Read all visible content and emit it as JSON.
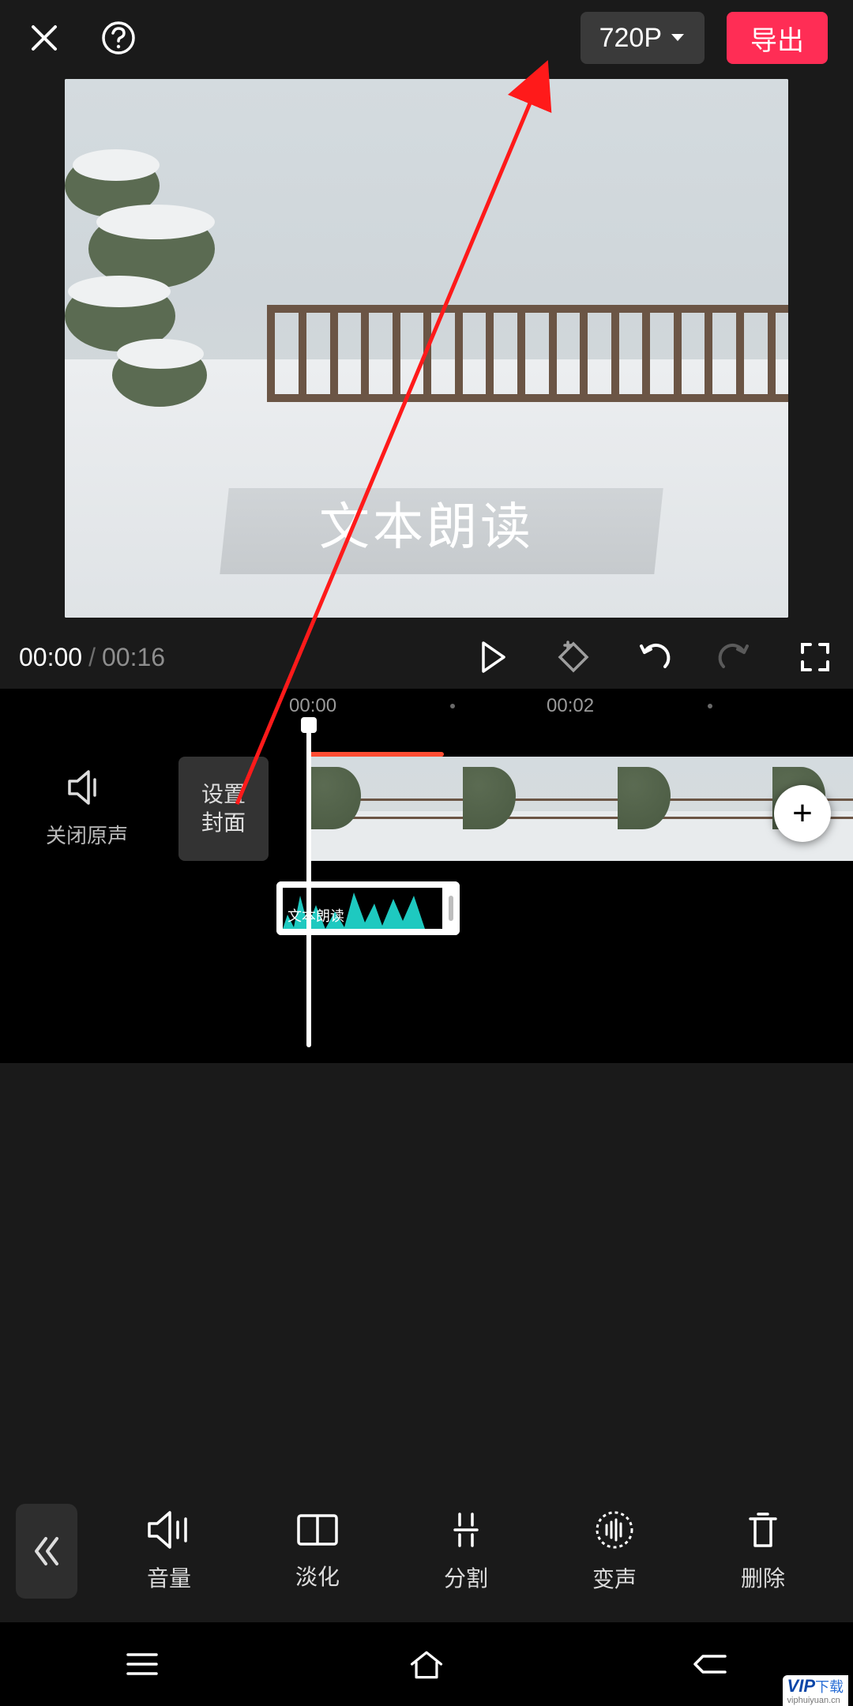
{
  "header": {
    "resolution_label": "720P",
    "export_label": "导出"
  },
  "preview": {
    "overlay_text": "文本朗读"
  },
  "playbar": {
    "current_time": "00:00",
    "duration": "00:16"
  },
  "ruler": {
    "tick_a": "00:00",
    "tick_b": "00:02"
  },
  "timeline": {
    "mute_label": "关闭原声",
    "cover_label": "设置\n封面",
    "audio_clip_label": "文本朗读"
  },
  "toolbar": {
    "items": [
      {
        "label": "音量",
        "icon": "volume-icon"
      },
      {
        "label": "淡化",
        "icon": "fade-icon"
      },
      {
        "label": "分割",
        "icon": "split-icon"
      },
      {
        "label": "变声",
        "icon": "voice-change-icon"
      },
      {
        "label": "删除",
        "icon": "delete-icon"
      }
    ]
  },
  "watermark": {
    "brand": "VIP",
    "sub": "下载",
    "site": "viphuiyuan.cn"
  },
  "colors": {
    "accent": "#ff2d55",
    "wave": "#1ec9c0"
  }
}
